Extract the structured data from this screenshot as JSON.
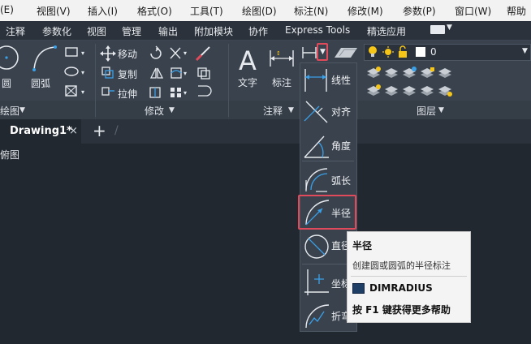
{
  "menu": [
    "(E)",
    "视图(V)",
    "插入(I)",
    "格式(O)",
    "工具(T)",
    "绘图(D)",
    "标注(N)",
    "修改(M)",
    "参数(P)",
    "窗口(W)",
    "帮助"
  ],
  "ribbon_tabs": [
    "注释",
    "参数化",
    "视图",
    "管理",
    "输出",
    "附加模块",
    "协作",
    "Express Tools",
    "精选应用"
  ],
  "draw_panel": {
    "circle": "圆",
    "arc": "圆弧",
    "label": "绘图"
  },
  "modify_panel": {
    "move": "移动",
    "copy": "复制",
    "stretch": "拉伸",
    "label": "修改"
  },
  "annotation_panel": {
    "text": "文字",
    "dimension": "标注",
    "label": "注释"
  },
  "layer_panel": {
    "label": "图层",
    "current_layer": "0"
  },
  "document": {
    "tab_title": "Drawing1*",
    "close": "×",
    "add": "+",
    "slash": "/"
  },
  "canvas_text": "俯图",
  "dropdown": [
    "线性",
    "对齐",
    "角度",
    "弧长",
    "半径",
    "直径",
    "坐标",
    "折弯"
  ],
  "tooltip": {
    "title": "半径",
    "description": "创建圆或圆弧的半径标注",
    "command": "DIMRADIUS",
    "help": "按 F1 键获得更多帮助"
  },
  "colors": {
    "highlight": "#e04a5b",
    "accent": "#3aa0e8",
    "bulb": "#f5c518"
  }
}
